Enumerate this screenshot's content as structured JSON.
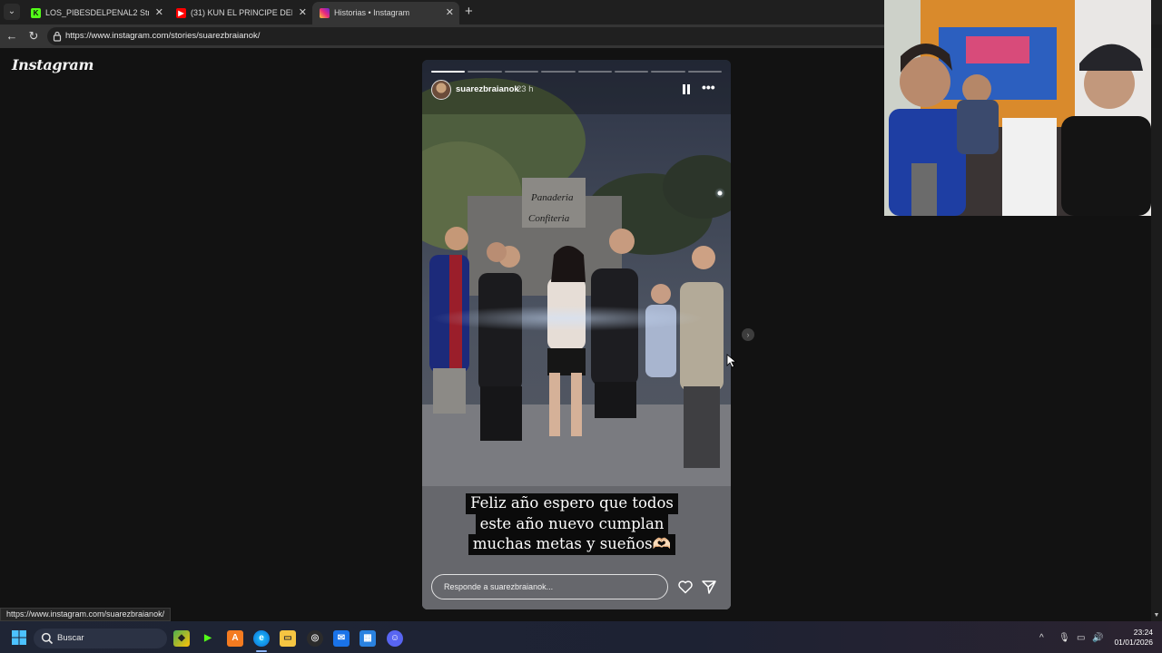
{
  "browser": {
    "tabs": [
      {
        "title": "LOS_PIBESDELPENAL2 Stream - W",
        "favicon": "kick-icon",
        "color": "#53fc18",
        "active": false
      },
      {
        "title": "(31) KUN EL PRINCIPE DEL ACORD",
        "favicon": "youtube-icon",
        "color": "#ff0000",
        "active": false
      },
      {
        "title": "Historias • Instagram",
        "favicon": "instagram-icon",
        "color": "#e1306c",
        "active": true
      }
    ],
    "url": "https://www.instagram.com/stories/suarezbraianok/",
    "status_url": "https://www.instagram.com/suarezbraianok/"
  },
  "instagram": {
    "logo": "Instagram",
    "story": {
      "username": "suarezbraianok",
      "time": "23 h",
      "segments_total": 8,
      "segments_done": 1,
      "caption_lines": [
        "Feliz año espero que todos",
        "este año nuevo cumplan",
        "muchas metas y sueños🫶🏻"
      ],
      "reply_placeholder": "Responde a suarezbraianok..."
    }
  },
  "taskbar": {
    "search_label": "Buscar",
    "time": "23:24",
    "date": "01/01/2026"
  }
}
